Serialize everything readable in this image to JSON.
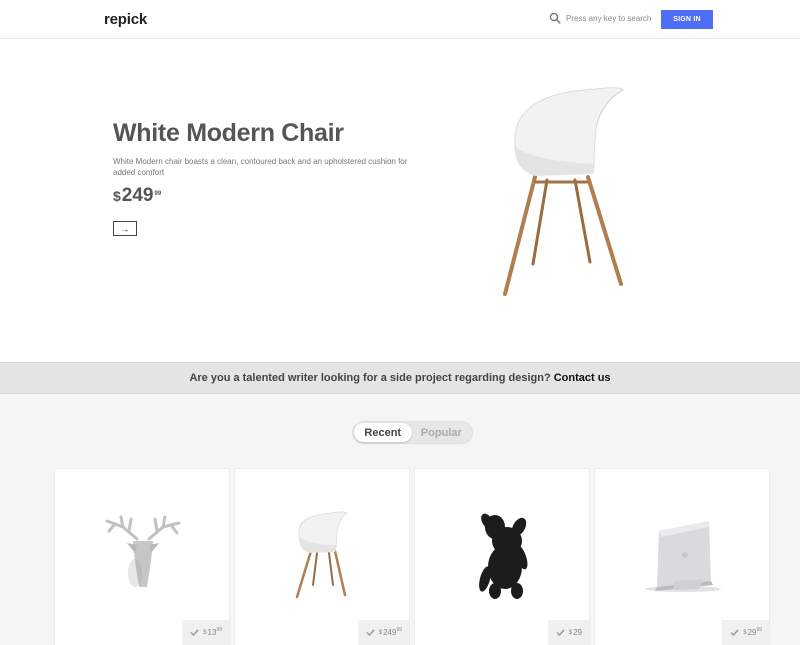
{
  "header": {
    "logo": "repick",
    "search_placeholder": "Press any key to search",
    "signin_label": "SIGN IN",
    "accent_color": "#4f6ef7"
  },
  "hero": {
    "title": "White Modern Chair",
    "description": "White Modern chair boasts a clean, contoured back and an upholstered cushion for added comfort",
    "price_currency": "$",
    "price_main": "249",
    "price_cents": "99",
    "arrow": "→",
    "image": "white-chair"
  },
  "banner": {
    "text": "Are you a talented writer looking for a side project regarding design?",
    "link": "Contact us"
  },
  "tabs": {
    "recent": "Recent",
    "popular": "Popular",
    "active": "Recent"
  },
  "products": [
    {
      "image": "deer-head-hook",
      "currency": "$",
      "price": "13",
      "cents": "99"
    },
    {
      "image": "white-chair",
      "currency": "$",
      "price": "249",
      "cents": "99"
    },
    {
      "image": "black-bear-figure",
      "currency": "$",
      "price": "29",
      "cents": ""
    },
    {
      "image": "laptop-stand",
      "currency": "$",
      "price": "29",
      "cents": "99"
    }
  ]
}
